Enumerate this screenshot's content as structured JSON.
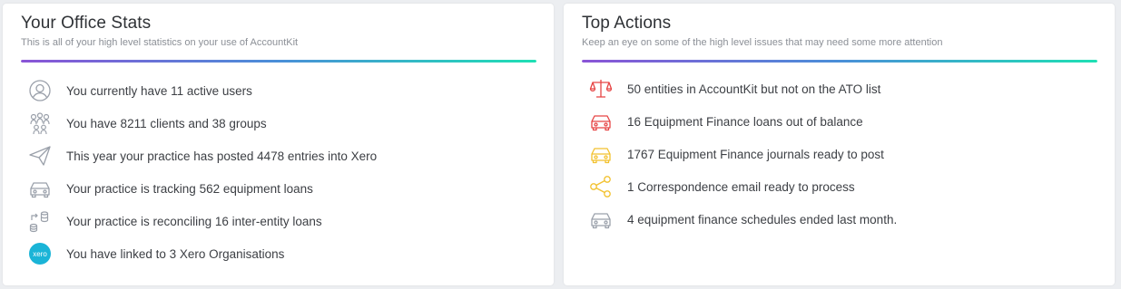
{
  "colors": {
    "gradient_start": "#8a54d6",
    "gradient_mid": "#4a8fd8",
    "gradient_end": "#1ee0b4",
    "icon_gray": "#9aa0aa",
    "icon_red": "#e64545",
    "icon_yellow": "#f2c12e",
    "xero_blue": "#1ab4d7"
  },
  "office_stats": {
    "title": "Your Office Stats",
    "subtitle": "This is all of your high level statistics on your use of AccountKit",
    "items": [
      {
        "icon": "user-circle-icon",
        "text": "You currently have 11 active users"
      },
      {
        "icon": "people-group-icon",
        "text": "You have 8211 clients and 38 groups"
      },
      {
        "icon": "paper-plane-icon",
        "text": "This year your practice has posted 4478 entries into Xero"
      },
      {
        "icon": "car-icon",
        "text": "Your practice is tracking 562 equipment loans"
      },
      {
        "icon": "coins-transfer-icon",
        "text": "Your practice is reconciling 16 inter-entity loans"
      },
      {
        "icon": "xero-logo-icon",
        "icon_text": "xero",
        "text": "You have linked to 3 Xero Organisations"
      }
    ]
  },
  "top_actions": {
    "title": "Top Actions",
    "subtitle": "Keep an eye on some of the high level issues that may need some more attention",
    "items": [
      {
        "icon": "scales-icon",
        "text": "50 entities in AccountKit but not on the ATO list"
      },
      {
        "icon": "car-red-icon",
        "text": "16  Equipment Finance loans out of balance"
      },
      {
        "icon": "car-yellow-icon",
        "text": "1767  Equipment Finance journals ready to post"
      },
      {
        "icon": "share-icon",
        "text": "1  Correspondence email ready to process"
      },
      {
        "icon": "car-gray-icon",
        "text": "4  equipment finance schedules ended last month."
      }
    ]
  }
}
